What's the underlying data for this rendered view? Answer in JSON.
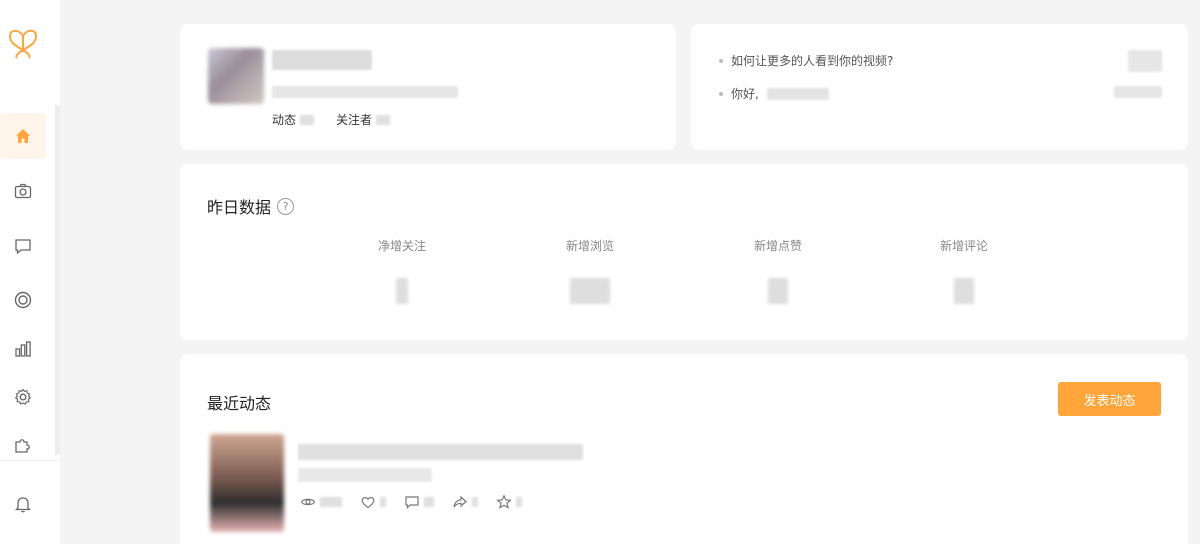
{
  "sidebar": {
    "logo_icon": "butterfly-logo-icon",
    "items": [
      {
        "icon": "home-icon",
        "active": true
      },
      {
        "icon": "camera-icon",
        "active": false
      },
      {
        "icon": "comment-icon",
        "active": false
      },
      {
        "icon": "target-icon",
        "active": false
      },
      {
        "icon": "bar-chart-icon",
        "active": false
      },
      {
        "icon": "gear-icon",
        "active": false
      },
      {
        "icon": "puzzle-icon",
        "active": false
      }
    ],
    "bell_icon": "bell-icon",
    "accent_color": "#ffa53a"
  },
  "profile": {
    "posts_label": "动态",
    "followers_label": "关注者"
  },
  "tips": {
    "items": [
      {
        "text": "如何让更多的人看到你的视频?"
      },
      {
        "text": "你好,"
      }
    ]
  },
  "stats": {
    "title": "昨日数据",
    "help": "?",
    "items": [
      {
        "label": "净增关注"
      },
      {
        "label": "新增浏览"
      },
      {
        "label": "新增点赞"
      },
      {
        "label": "新增评论"
      }
    ]
  },
  "recent": {
    "title": "最近动态",
    "publish_label": "发表动态"
  }
}
